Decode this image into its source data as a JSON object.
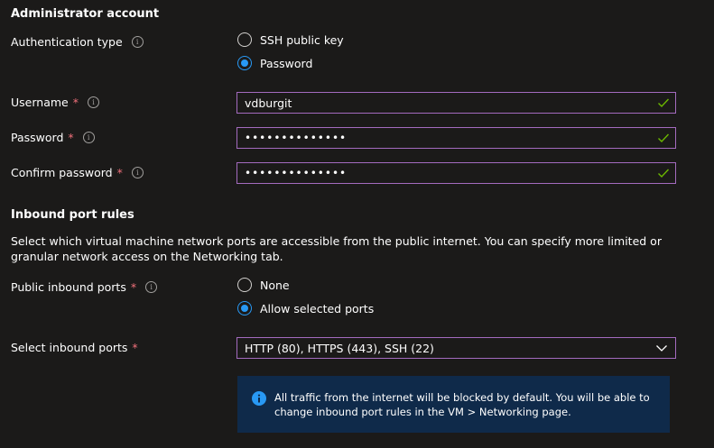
{
  "admin": {
    "title": "Administrator account",
    "auth_type_label": "Authentication type",
    "auth_options": [
      "SSH public key",
      "Password"
    ],
    "auth_selected": "Password",
    "username_label": "Username",
    "username_value": "vdburgit",
    "password_label": "Password",
    "password_value": "••••••••••••••",
    "confirm_label": "Confirm password",
    "confirm_value": "••••••••••••••",
    "required_mark": "*",
    "info_glyph": "i"
  },
  "inbound": {
    "title": "Inbound port rules",
    "description": "Select which virtual machine network ports are accessible from the public internet. You can specify more limited or granular network access on the Networking tab.",
    "public_ports_label": "Public inbound ports",
    "public_options": [
      "None",
      "Allow selected ports"
    ],
    "public_selected": "Allow selected ports",
    "select_ports_label": "Select inbound ports",
    "select_ports_value": "HTTP (80), HTTPS (443), SSH (22)",
    "notice": "All traffic from the internet will be blocked by default. You will be able to change inbound port rules in the VM > Networking page."
  },
  "colors": {
    "background": "#1b1a19",
    "accent": "#2899f5",
    "field_border": "#a46bbf",
    "valid_check": "#6bb700",
    "required": "#f1707b",
    "info_box": "#0f2a4a"
  },
  "icons": {
    "valid": "check-icon",
    "info": "info-icon",
    "dropdown": "chevron-down-icon"
  }
}
